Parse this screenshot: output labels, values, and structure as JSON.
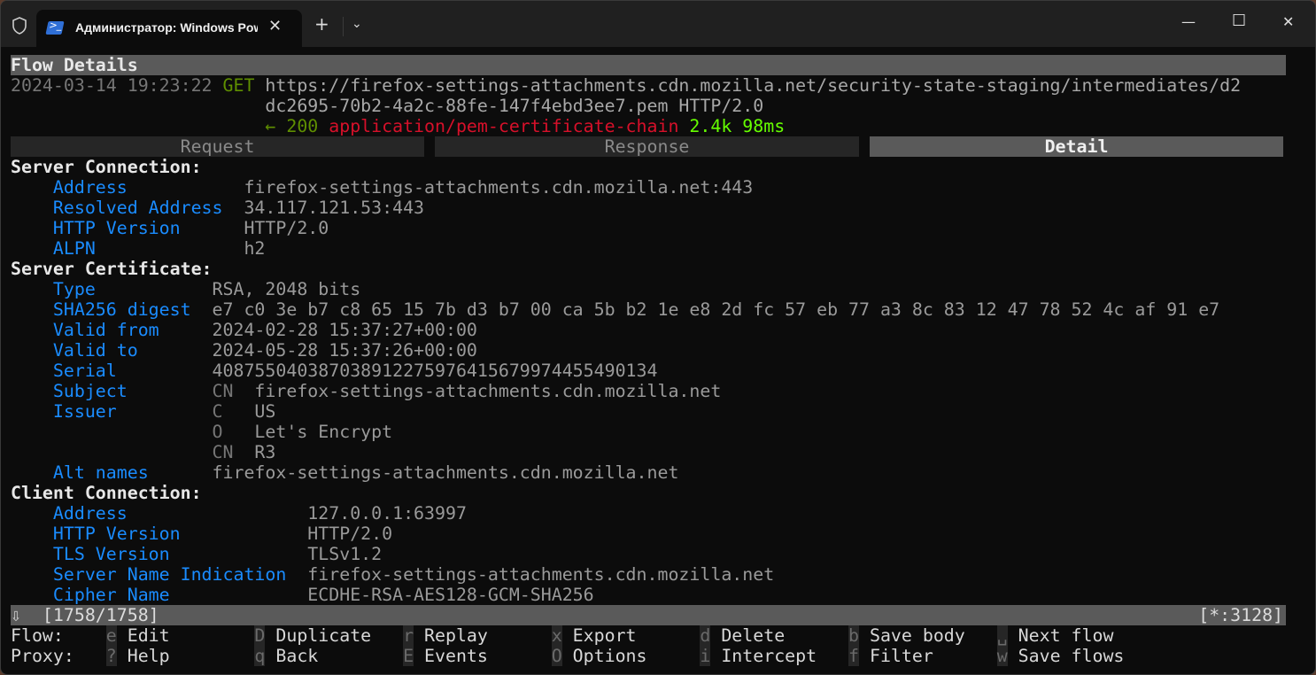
{
  "window": {
    "tab_title": "Администратор: Windows PowerShell",
    "new_tab": "+",
    "dropdown": "⌄",
    "close_tab": "✕",
    "minimize": "—",
    "maximize": "☐",
    "close": "✕"
  },
  "flow": {
    "heading": "Flow Details",
    "timestamp": "2024-03-14 19:23:22",
    "method": "GET",
    "url_line1": "https://firefox-settings-attachments.cdn.mozilla.net/security-state-staging/intermediates/d2",
    "url_line2": "dc2695-70b2-4a2c-88fe-147f4ebd3ee7.pem HTTP/2.0",
    "arrow": "←",
    "status": "200",
    "content_type": "application/pem-certificate-chain",
    "size": "2.4k",
    "duration": "98ms"
  },
  "tabs": [
    {
      "label": "Request"
    },
    {
      "label": "Response"
    },
    {
      "label": "Detail"
    }
  ],
  "server_connection": {
    "title": "Server Connection:",
    "rows": [
      {
        "key": "Address",
        "value": "firefox-settings-attachments.cdn.mozilla.net:443"
      },
      {
        "key": "Resolved Address",
        "value": "34.117.121.53:443"
      },
      {
        "key": "HTTP Version",
        "value": "HTTP/2.0"
      },
      {
        "key": "ALPN",
        "value": "h2"
      }
    ]
  },
  "server_certificate": {
    "title": "Server Certificate:",
    "type_key": "Type",
    "type": "RSA, 2048 bits",
    "sha_key": "SHA256 digest",
    "sha": "e7 c0 3e b7 c8 65 15 7b d3 b7 00 ca 5b b2 1e e8 2d fc 57 eb 77 a3 8c 83 12 47 78 52 4c af 91 e7",
    "from_key": "Valid from",
    "from": "2024-02-28 15:37:27+00:00",
    "to_key": "Valid to",
    "to": "2024-05-28 15:37:26+00:00",
    "serial_key": "Serial",
    "serial": "408755040387038912275976415679974455490134",
    "subject_key": "Subject",
    "subject_cn_label": "CN",
    "subject_cn": "firefox-settings-attachments.cdn.mozilla.net",
    "issuer_key": "Issuer",
    "issuer": [
      {
        "k": "C",
        "v": "US"
      },
      {
        "k": "O",
        "v": "Let's Encrypt"
      },
      {
        "k": "CN",
        "v": "R3"
      }
    ],
    "alt_key": "Alt names",
    "alt": "firefox-settings-attachments.cdn.mozilla.net"
  },
  "client_connection": {
    "title": "Client Connection:",
    "rows": [
      {
        "key": "Address",
        "value": "127.0.0.1:63997"
      },
      {
        "key": "HTTP Version",
        "value": "HTTP/2.0"
      },
      {
        "key": "TLS Version",
        "value": "TLSv1.2"
      },
      {
        "key": "Server Name Indication",
        "value": "firefox-settings-attachments.cdn.mozilla.net"
      },
      {
        "key": "Cipher Name",
        "value": "ECDHE-RSA-AES128-GCM-SHA256"
      }
    ]
  },
  "statusbar": {
    "arrow": "⇩",
    "position": "[1758/1758]",
    "listen": "[*:3128]"
  },
  "keys": {
    "flow_label": "Flow:",
    "proxy_label": "Proxy:",
    "flow": [
      {
        "k": "e",
        "v": "Edit"
      },
      {
        "k": "D",
        "v": "Duplicate"
      },
      {
        "k": "r",
        "v": "Replay"
      },
      {
        "k": "x",
        "v": "Export"
      },
      {
        "k": "d",
        "v": "Delete"
      },
      {
        "k": "b",
        "v": "Save body"
      },
      {
        "k": "␣",
        "v": "Next flow"
      }
    ],
    "proxy": [
      {
        "k": "?",
        "v": "Help"
      },
      {
        "k": "q",
        "v": "Back"
      },
      {
        "k": "E",
        "v": "Events"
      },
      {
        "k": "O",
        "v": "Options"
      },
      {
        "k": "i",
        "v": "Intercept"
      },
      {
        "k": "f",
        "v": "Filter"
      },
      {
        "k": "w",
        "v": "Save flows"
      }
    ]
  }
}
